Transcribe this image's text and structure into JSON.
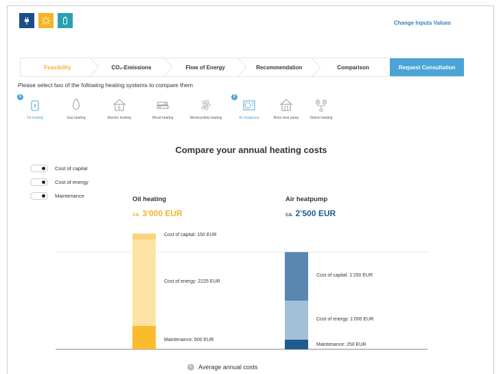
{
  "header": {
    "icons": [
      {
        "name": "plug-icon",
        "bg": "#1a4f8a"
      },
      {
        "name": "sun-icon",
        "bg": "#f3b521"
      },
      {
        "name": "battery-icon",
        "bg": "#2aa0b5"
      }
    ],
    "change_link": "Change Inputs Values"
  },
  "steps": [
    {
      "label": "Feasibility",
      "active": true
    },
    {
      "label": "CO₂-Emissions"
    },
    {
      "label": "Flow of Energy"
    },
    {
      "label": "Recommendation"
    },
    {
      "label": "Comparison"
    },
    {
      "label": "Request Consultation"
    }
  ],
  "instruction": "Please select two of the following heating systems to compare them",
  "systems": [
    {
      "label": "Oil heating",
      "badge": "1",
      "icon": "oil-tank-icon"
    },
    {
      "label": "Gas heating",
      "icon": "flame-icon"
    },
    {
      "label": "Electric heating",
      "icon": "house-bolt-icon"
    },
    {
      "label": "Wood heating",
      "icon": "wood-logs-icon"
    },
    {
      "label": "Wood-pellets heating",
      "icon": "pellets-icon"
    },
    {
      "label": "Air heatpump",
      "badge": "2",
      "icon": "air-heatpump-icon"
    },
    {
      "label": "Brine heat pump",
      "icon": "house-heatpump-icon"
    },
    {
      "label": "District heating",
      "icon": "district-network-icon"
    }
  ],
  "compare_title": "Compare your annual heating costs",
  "toggles": [
    {
      "label": "Cost of capital"
    },
    {
      "label": "Cost of energy"
    },
    {
      "label": "Maintenance"
    }
  ],
  "left": {
    "title": "Oil heating",
    "ca": "ca.",
    "total": "3'000 EUR",
    "total_color": "#f2b233"
  },
  "right": {
    "title": "Air heatpump",
    "ca": "ca.",
    "total": "2’500 EUR",
    "total_color": "#1f5b8e"
  },
  "chart_data": {
    "type": "bar",
    "stacked": true,
    "categories": [
      "Oil heating",
      "Air heatpump"
    ],
    "series": [
      {
        "name": "Cost of capital",
        "values": [
          150,
          1250
        ],
        "colors": [
          "#fdd27d",
          "#5987b0"
        ]
      },
      {
        "name": "Cost of energy",
        "values": [
          2225,
          1000
        ],
        "colors": [
          "#fde3a3",
          "#a3bfd8"
        ]
      },
      {
        "name": "Maintenance",
        "values": [
          600,
          250
        ],
        "colors": [
          "#fbbb2f",
          "#1f5b8e"
        ]
      }
    ],
    "labels": {
      "left": [
        "Cost of capital: 150 EUR",
        "Cost of energy: 2225 EUR",
        "Maintenance: 600 EUR"
      ],
      "right": [
        "Cost of capital: 1’250 EUR",
        "Cost of energy: 1’000 EUR",
        "Maintenance: 250 EUR"
      ]
    },
    "reference_line": 2500,
    "ylim": [
      0,
      3000
    ],
    "footer": "Average annual costs"
  }
}
